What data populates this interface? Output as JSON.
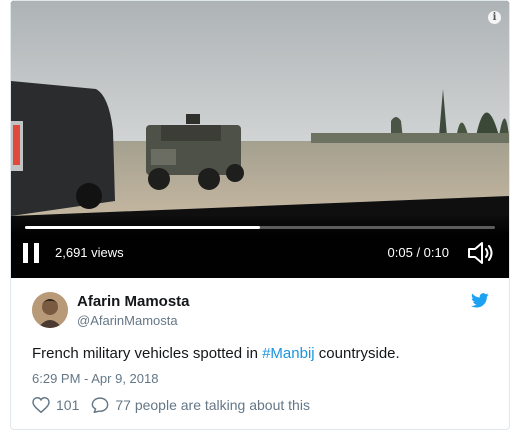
{
  "video": {
    "views": "2,691 views",
    "time": "0:05 / 0:10",
    "progress": 0.5
  },
  "tweet": {
    "author_name": "Afarin Mamosta",
    "author_handle": "@AfarinMamosta",
    "text_before": "French military vehicles spotted in ",
    "hashtag": "#Manbij",
    "text_after": " countryside.",
    "timestamp": "6:29 PM - Apr 9, 2018",
    "like_count": "101",
    "talking_text": "77 people are talking about this"
  },
  "colors": {
    "link": "#1b95e0",
    "muted": "#657786"
  },
  "icons": [
    "info-icon",
    "pause-icon",
    "volume-icon",
    "twitter-bird-icon",
    "heart-icon",
    "reply-bubble-icon"
  ]
}
